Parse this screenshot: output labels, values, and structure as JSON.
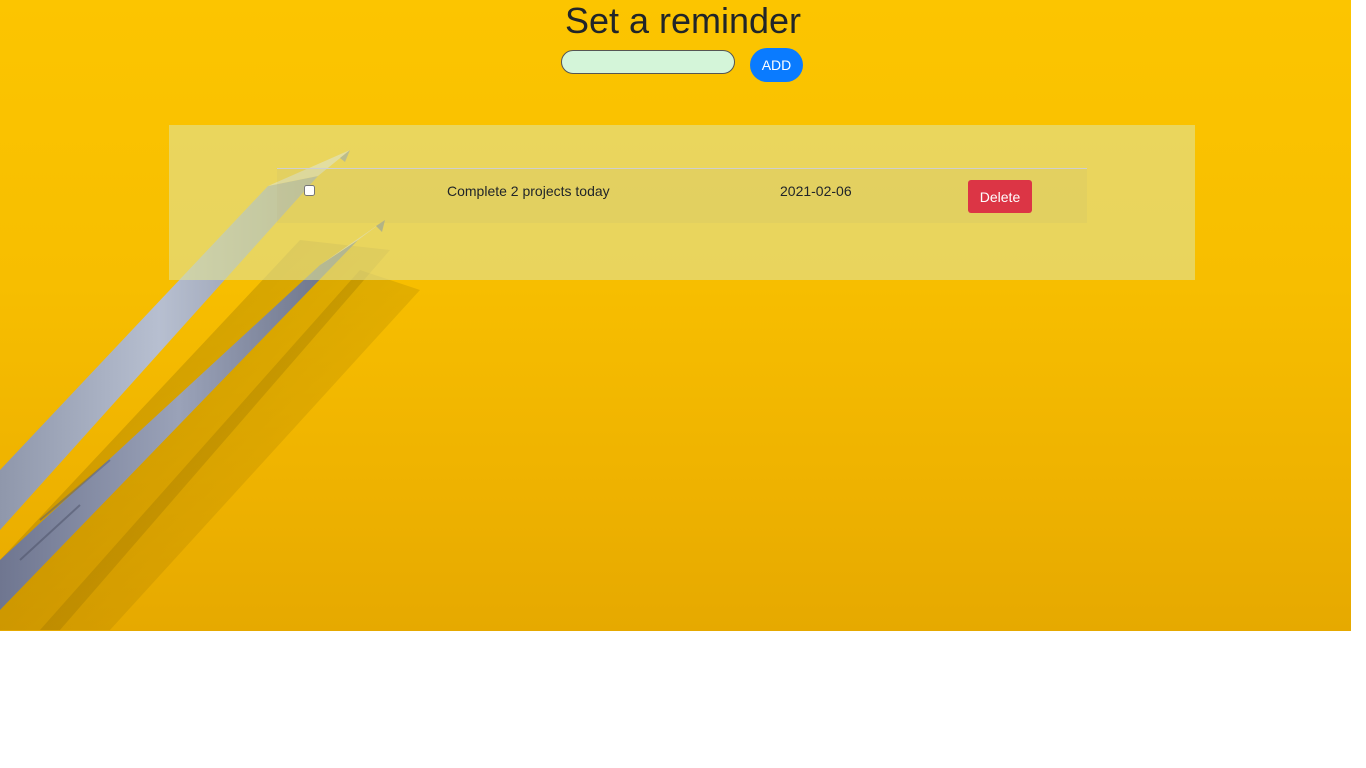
{
  "header": {
    "title": "Set a reminder"
  },
  "form": {
    "input_value": "",
    "add_label": "ADD"
  },
  "reminders": [
    {
      "checked": false,
      "task": "Complete 2 projects today",
      "date": "2021-02-06",
      "delete_label": "Delete"
    }
  ],
  "colors": {
    "background_yellow": "#f7be00",
    "add_button": "#0a7bff",
    "delete_button": "#dc3545",
    "input_fill": "#d4f5d9",
    "panel": "#e1e296"
  },
  "icons": {
    "background": "pencils-photo"
  }
}
